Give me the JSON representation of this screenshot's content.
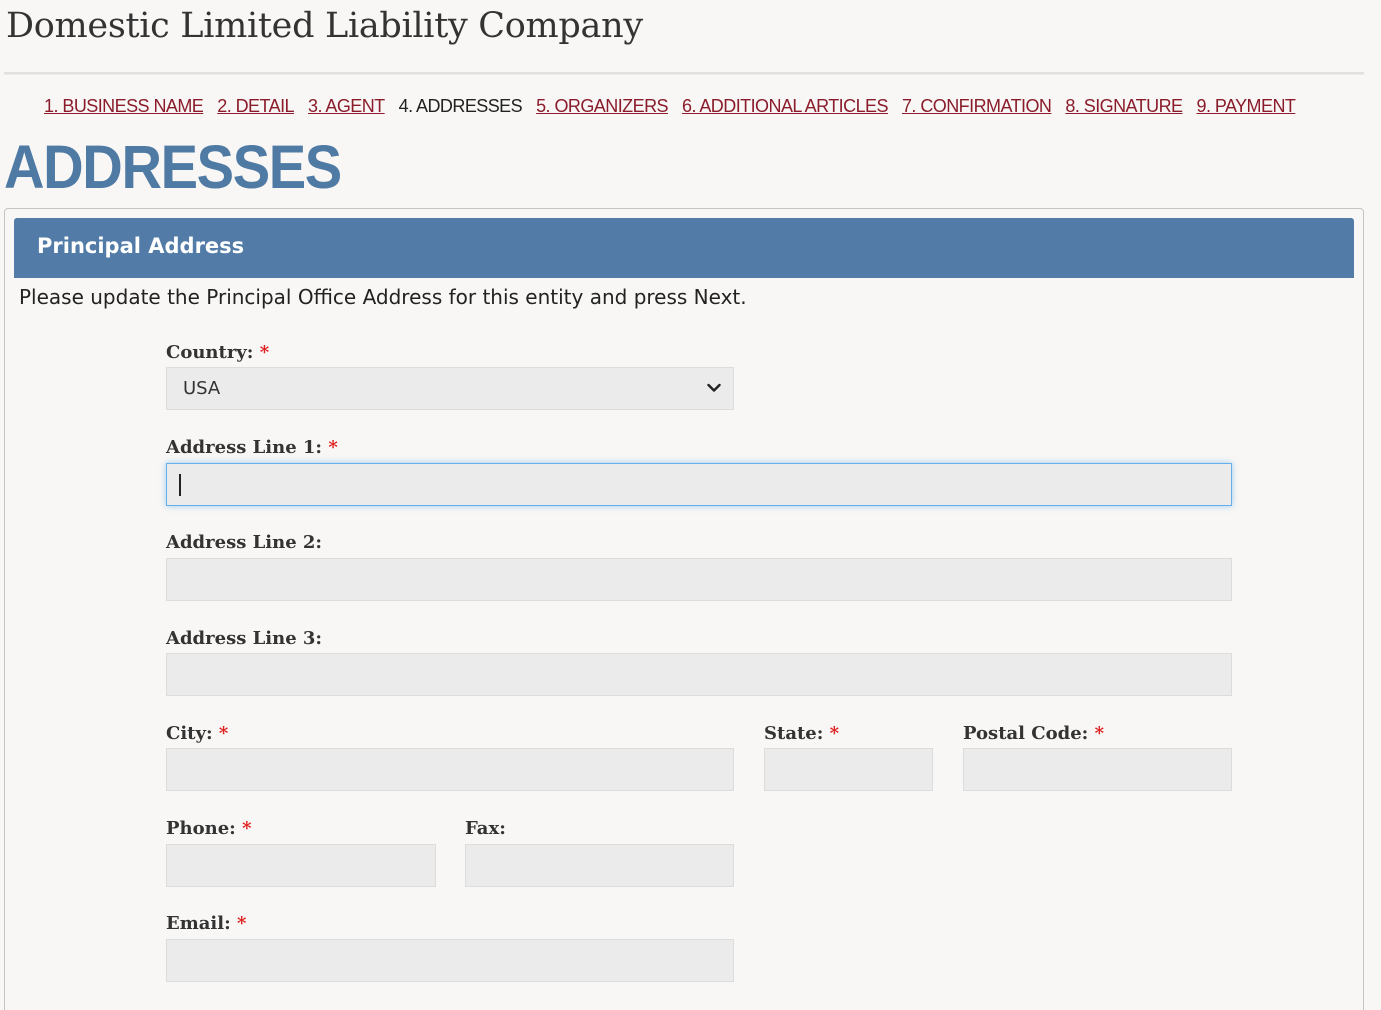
{
  "header": {
    "title": "Domestic Limited Liability Company"
  },
  "steps": [
    {
      "label": "1. BUSINESS NAME",
      "current": false
    },
    {
      "label": "2. DETAIL",
      "current": false
    },
    {
      "label": "3. AGENT",
      "current": false
    },
    {
      "label": "4. ADDRESSES",
      "current": true
    },
    {
      "label": "5. ORGANIZERS",
      "current": false
    },
    {
      "label": "6. ADDITIONAL ARTICLES",
      "current": false
    },
    {
      "label": "7. CONFIRMATION",
      "current": false
    },
    {
      "label": "8. SIGNATURE",
      "current": false
    },
    {
      "label": "9. PAYMENT",
      "current": false
    }
  ],
  "page_title": "ADDRESSES",
  "panel": {
    "heading": "Principal Address",
    "instructions": "Please update the Principal Office Address for this entity and press Next."
  },
  "form": {
    "required_marker": "*",
    "country": {
      "label": "Country:",
      "value": "USA",
      "icon": "chevron-down-icon"
    },
    "address1": {
      "label": "Address Line 1:",
      "value": ""
    },
    "address2": {
      "label": "Address Line 2:",
      "value": ""
    },
    "address3": {
      "label": "Address Line 3:",
      "value": ""
    },
    "city": {
      "label": "City:",
      "value": ""
    },
    "state": {
      "label": "State:",
      "value": ""
    },
    "postal": {
      "label": "Postal Code:",
      "value": ""
    },
    "phone": {
      "label": "Phone:",
      "value": ""
    },
    "fax": {
      "label": "Fax:",
      "value": ""
    },
    "email": {
      "label": "Email:",
      "value": ""
    }
  },
  "colors": {
    "link": "#8a1c2b",
    "title": "#4f7aa3",
    "panel_heading": "#527ca7",
    "required": "#e02020",
    "focus": "#66afe9"
  }
}
